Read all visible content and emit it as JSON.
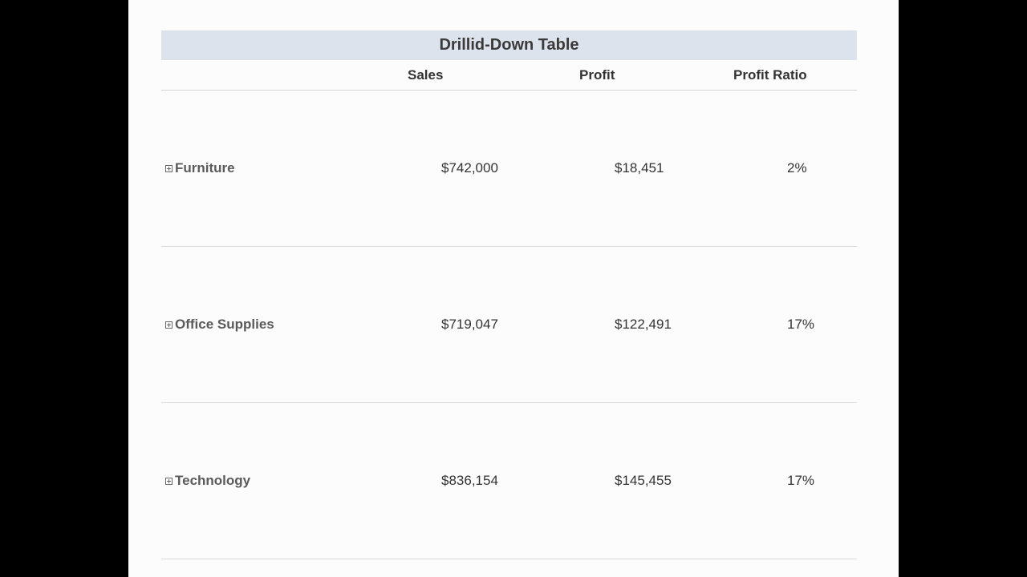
{
  "title": "Drillid-Down Table",
  "columns": [
    "Sales",
    "Profit",
    "Profit Ratio"
  ],
  "rows": [
    {
      "category": "Furniture",
      "sales": "$742,000",
      "profit": "$18,451",
      "profit_ratio": "2%"
    },
    {
      "category": "Office Supplies",
      "sales": "$719,047",
      "profit": "$122,491",
      "profit_ratio": "17%"
    },
    {
      "category": "Technology",
      "sales": "$836,154",
      "profit": "$145,455",
      "profit_ratio": "17%"
    }
  ],
  "icons": {
    "expand": "expand-plus-icon"
  },
  "colors": {
    "title_bg": "#dde3ed",
    "page_bg": "#fcfcfc",
    "outer_bg": "#000000"
  }
}
